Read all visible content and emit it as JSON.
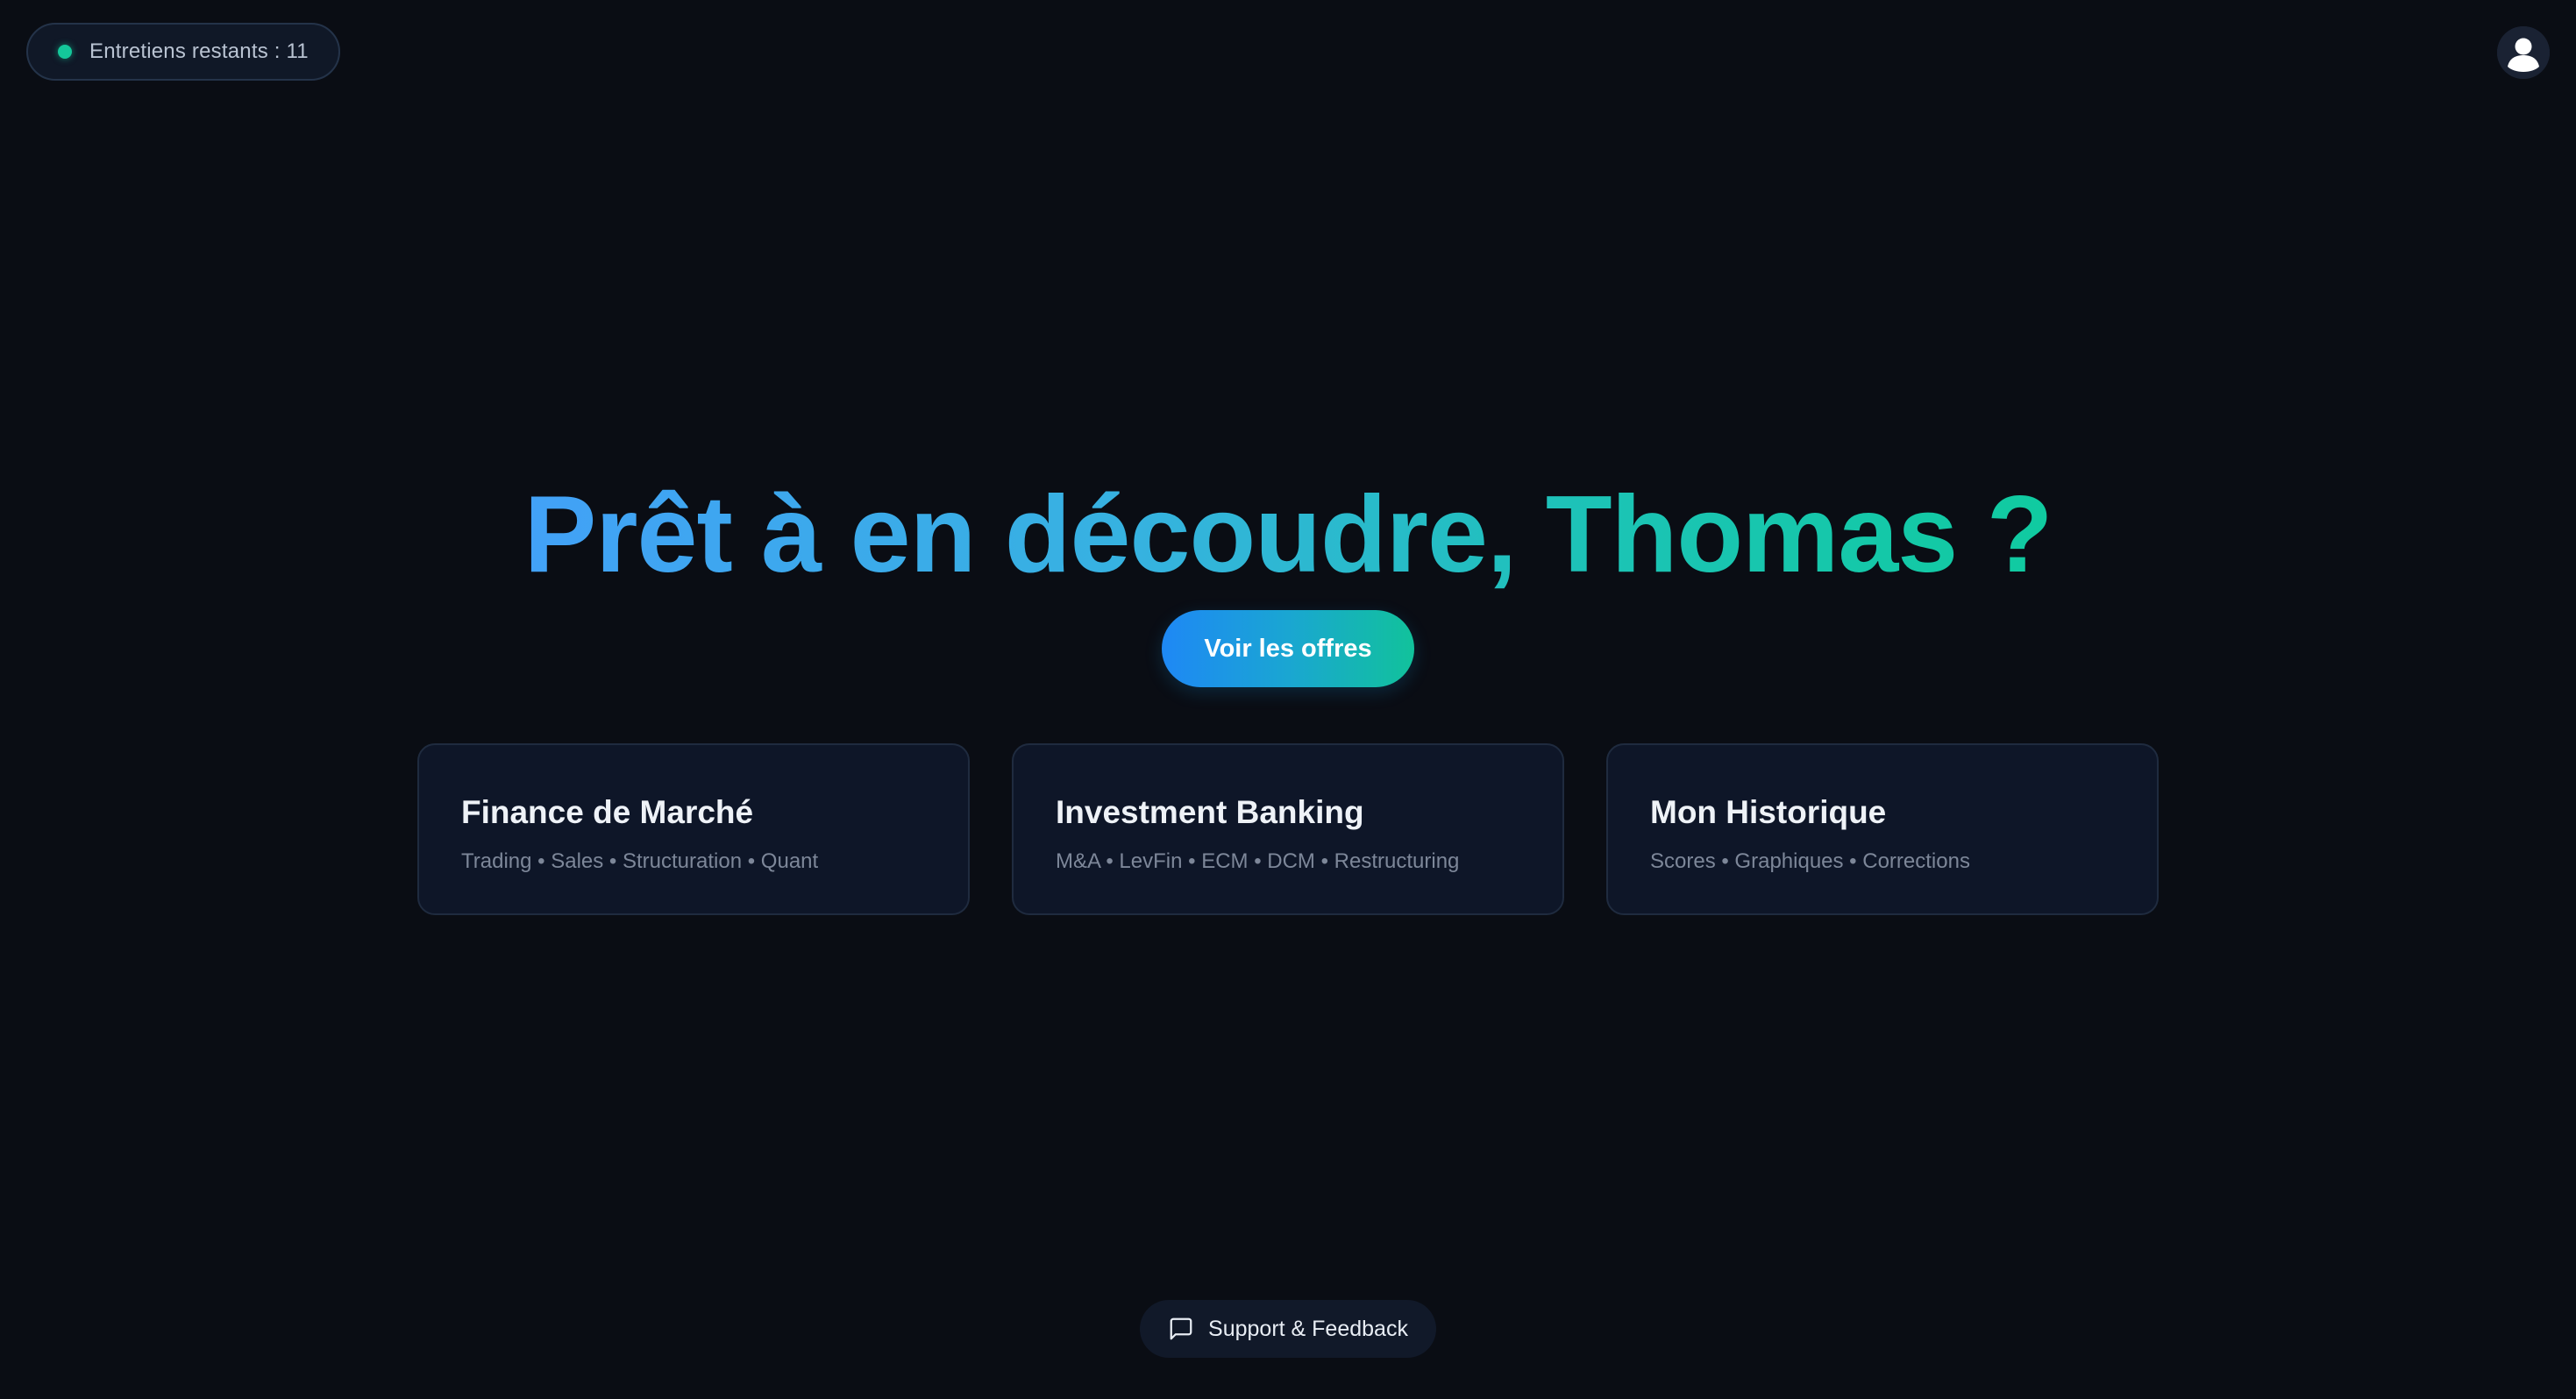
{
  "header": {
    "credits_label": "Entretiens restants : 11",
    "status_color": "#14c79a",
    "avatar_icon": "user-icon"
  },
  "hero": {
    "title": "Prêt à en découdre, Thomas ?",
    "cta_label": "Voir les offres",
    "gradient": [
      "#42a1f7",
      "#10cba0"
    ]
  },
  "cards": [
    {
      "title": "Finance de Marché",
      "subtitle": "Trading • Sales • Structuration • Quant"
    },
    {
      "title": "Investment Banking",
      "subtitle": "M&A • LevFin • ECM • DCM • Restructuring"
    },
    {
      "title": "Mon Historique",
      "subtitle": "Scores • Graphiques • Corrections"
    }
  ],
  "footer": {
    "support_label": "Support & Feedback",
    "support_icon": "message-square-icon"
  }
}
